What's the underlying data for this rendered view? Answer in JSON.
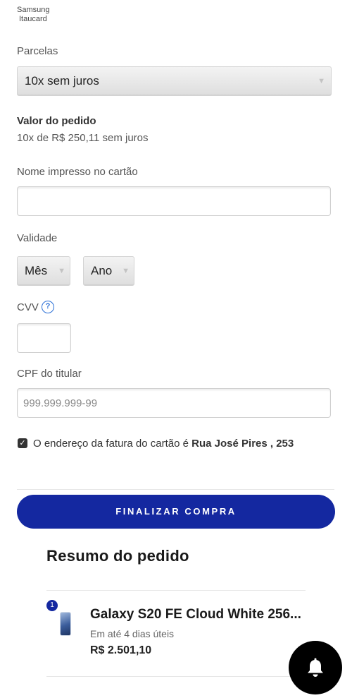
{
  "bank": {
    "line1": "Samsung",
    "line2": "Itaucard"
  },
  "installments": {
    "label": "Parcelas",
    "selected": "10x sem juros"
  },
  "order_value": {
    "label": "Valor do pedido",
    "detail": "10x de R$ 250,11 sem juros"
  },
  "name_field": {
    "label": "Nome impresso no cartão",
    "value": "",
    "placeholder": ""
  },
  "validity": {
    "label": "Validade",
    "month": "Mês",
    "year": "Ano"
  },
  "cvv": {
    "label": "CVV",
    "help_icon": "question-circle-icon",
    "value": ""
  },
  "cpf": {
    "label": "CPF do titular",
    "placeholder": "999.999.999-99"
  },
  "billing": {
    "checked": true,
    "text": "O endereço da fatura do cartão é ",
    "address": "Rua José Pires , 253"
  },
  "finalize_button": "FINALIZAR COMPRA",
  "summary": {
    "title": "Resumo do pedido",
    "items": [
      {
        "quantity": "1",
        "name": "Galaxy S20 FE Cloud White 256...",
        "delivery": "Em até 4 dias úteis",
        "price": "R$ 2.501,10"
      }
    ]
  },
  "fab_icon": "bell-icon",
  "colors": {
    "primary": "#1428a0",
    "help_blue": "#2a6fd6",
    "fab": "#000000"
  }
}
